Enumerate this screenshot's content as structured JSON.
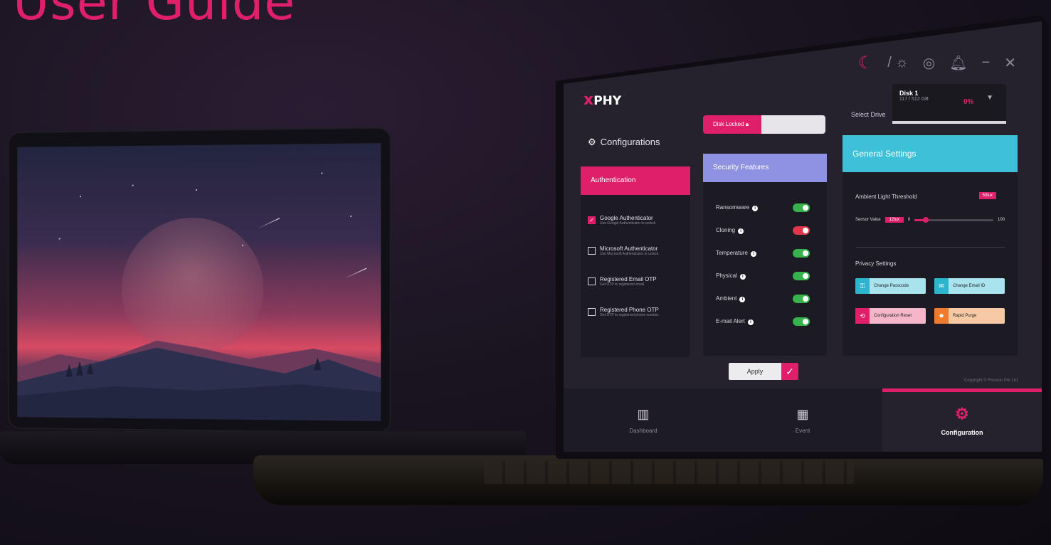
{
  "headline": "User Guide",
  "app": {
    "logo": "PHY",
    "titlebar_icons": [
      "moon-icon",
      "sun-icon",
      "support-icon",
      "bell-icon",
      "minimize-icon",
      "close-icon"
    ],
    "select_drive_label": "Select Drive",
    "drive": {
      "name": "Disk 1",
      "size": "117 / 512 GB",
      "percent": "0%"
    },
    "disk_locked_label": "Disk Locked",
    "configurations_title": "Configurations",
    "authentication": {
      "header": "Authentication",
      "items": [
        {
          "label": "Google Authenticator",
          "sub": "Use Google Authenticator to unlock",
          "checked": true
        },
        {
          "label": "Microsoft Authenticator",
          "sub": "Use Microsoft Authenticator to unlock",
          "checked": false
        },
        {
          "label": "Registered Email OTP",
          "sub": "Get OTP to registered email",
          "checked": false
        },
        {
          "label": "Registered Phone OTP",
          "sub": "Get OTP to registered phone number",
          "checked": false
        }
      ]
    },
    "security": {
      "header": "Security Features",
      "items": [
        {
          "label": "Ransomware",
          "on": true
        },
        {
          "label": "Cloning",
          "on": false
        },
        {
          "label": "Temperature",
          "on": true
        },
        {
          "label": "Physical",
          "on": true
        },
        {
          "label": "Ambient",
          "on": true
        },
        {
          "label": "E-mail Alert",
          "on": true
        }
      ]
    },
    "general": {
      "header": "General Settings",
      "ambient_label": "Ambient Light Threshold",
      "lux_badge": "50lux",
      "sensor_label": "Sensor Value",
      "sensor_value": "12lux",
      "slider_min": "0",
      "slider_max": "100",
      "slider_level": 0.14,
      "privacy_title": "Privacy Settings",
      "privacy_buttons": [
        {
          "label": "Change Passcode",
          "style": "cyan"
        },
        {
          "label": "Change Email ID",
          "style": "cyan"
        },
        {
          "label": "Configuration Reset",
          "style": "pink"
        },
        {
          "label": "Rapid Purge",
          "style": "orange"
        }
      ]
    },
    "apply_label": "Apply",
    "copyright": "Copyright © Flexxon Pte Ltd",
    "nav": [
      {
        "label": "Dashboard",
        "icon": "dashboard-icon",
        "active": false
      },
      {
        "label": "Event",
        "icon": "calendar-icon",
        "active": false
      },
      {
        "label": "Configuration",
        "icon": "configuration-gear-icon",
        "active": true
      }
    ]
  },
  "colors": {
    "accent": "#e01f6a",
    "security": "#8f92e0",
    "general": "#3ec0d8",
    "toggle_on": "#37b24d",
    "toggle_off": "#e0354a"
  }
}
